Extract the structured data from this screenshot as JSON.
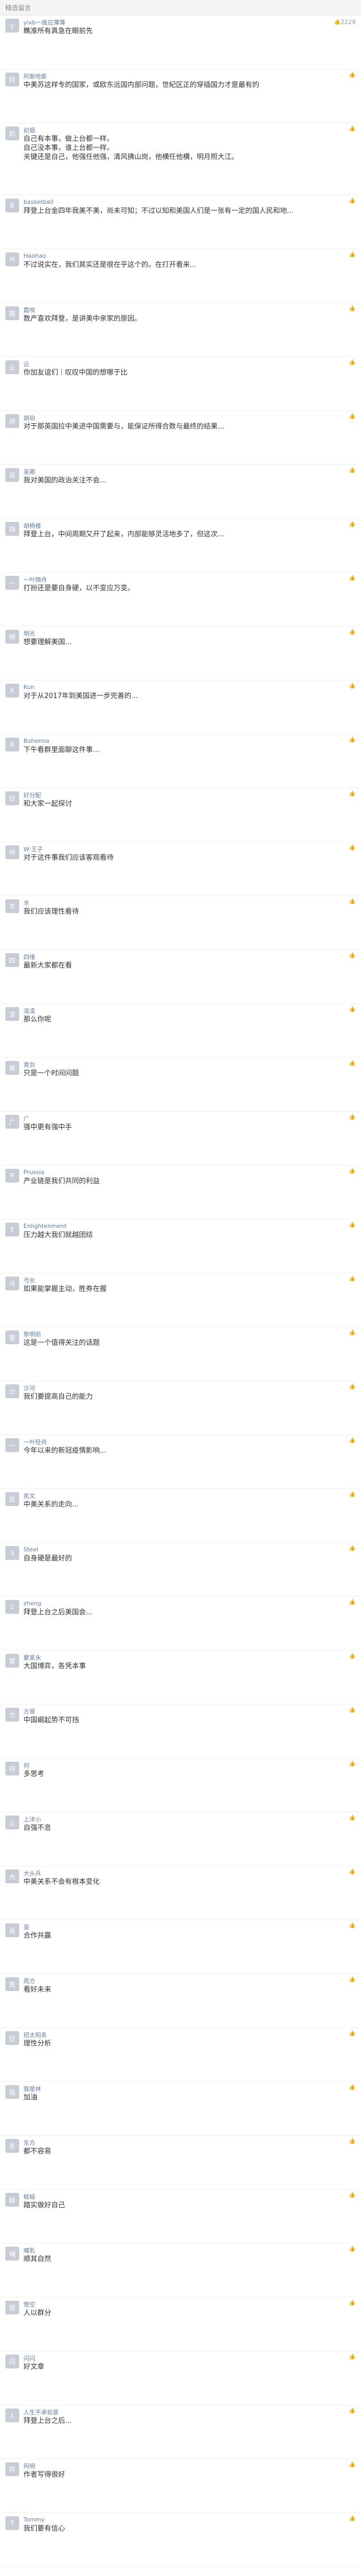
{
  "header": {
    "title": "精选留言"
  },
  "comments": [
    {
      "avatar": "y",
      "name": "yixb一拨应薄薄",
      "time": "",
      "likes": "2229",
      "text": "瞧准所有真急在眼前先"
    },
    {
      "avatar": "阿",
      "name": "阿斯哈斯",
      "time": "",
      "likes": "",
      "text": "中美苏这样专的国家，或欧东远国内部问题，世紀区正的穿插国力才是最有的"
    },
    {
      "avatar": "初",
      "name": "初烟",
      "time": "",
      "likes": "",
      "text": "自己有本事，做上台都一样。\n自己没本事，谁上台都一样。\n关键还是自己，他强任他强，清风拂山岗，他横任他横，明月照大江。"
    },
    {
      "avatar": "B",
      "name": "basketball",
      "time": "",
      "likes": "",
      "text": "拜登上台金四年我美不美，尚未可知；不过以知和美国人们是一张有一定的国人民和地..."
    },
    {
      "avatar": "H",
      "name": "Haohao",
      "time": "",
      "likes": "",
      "text": "不过说实在，我们其实还是很在乎这个的。在打开看来..."
    },
    {
      "avatar": "霞",
      "name": "霞咲",
      "time": "",
      "likes": "",
      "text": "数产喜欢拜登，是讲美中亲家的原因。"
    },
    {
      "avatar": "云",
      "name": "云",
      "time": "",
      "likes": "",
      "text": "你加友谊们｜叹叹中国的想哪于比"
    },
    {
      "avatar": "胡",
      "name": "胡珀",
      "time": "",
      "likes": "",
      "text": "对于那英国拉中美进中国需要与，能保证所得合数与最终的结果..."
    },
    {
      "avatar": "吴",
      "name": "吴卿",
      "time": "",
      "likes": "",
      "text": "我对美国的政治关注不会..."
    },
    {
      "avatar": "胡",
      "name": "胡杨楼",
      "time": "",
      "likes": "",
      "text": "拜登上台，中间周期又开了起来，内部能够灵活地多了，但这次..."
    },
    {
      "avatar": "一",
      "name": "一叶随舟",
      "time": "",
      "likes": "",
      "text": "打扮还是要自身硬，以不变应万变。"
    },
    {
      "avatar": "明",
      "name": "明光",
      "time": "",
      "likes": "",
      "text": "想要理解美国..."
    },
    {
      "avatar": "K",
      "name": "Kun",
      "time": "",
      "likes": "",
      "text": "对于从2017年到美国进一步完善的..."
    },
    {
      "avatar": "B",
      "name": "Bohemia",
      "time": "",
      "likes": "",
      "text": "下午看群里面聊这件事..."
    },
    {
      "avatar": "好",
      "name": "好分配",
      "time": "",
      "likes": "",
      "text": "和大家一起探讨"
    },
    {
      "avatar": "W",
      "name": "W·王子",
      "time": "",
      "likes": "",
      "text": "对于这件事我们应该客观看待"
    },
    {
      "avatar": "羊",
      "name": "羊",
      "time": "",
      "likes": "",
      "text": "我们应该理性看待"
    },
    {
      "avatar": "四",
      "name": "四维",
      "time": "",
      "likes": "",
      "text": "最新大家都在看"
    },
    {
      "avatar": "凌",
      "name": "凌凌",
      "time": "",
      "likes": "",
      "text": "那么你呢"
    },
    {
      "avatar": "青",
      "name": "青剑",
      "time": "",
      "likes": "",
      "text": "只是一个时间问题"
    },
    {
      "avatar": "广",
      "name": "广",
      "time": "",
      "likes": "",
      "text": "强中更有强中手"
    },
    {
      "avatar": "P",
      "name": "Prussia",
      "time": "",
      "likes": "",
      "text": "产业链是我们共同的利益"
    },
    {
      "avatar": "E",
      "name": "Enlightenment",
      "time": "",
      "likes": "",
      "text": "压力越大我们就越团结"
    },
    {
      "avatar": "弓",
      "name": "弓长",
      "time": "",
      "likes": "",
      "text": "如果能掌握主动，胜券在握"
    },
    {
      "avatar": "黎",
      "name": "黎明前",
      "time": "",
      "likes": "",
      "text": "这是一个值得关注的话题"
    },
    {
      "avatar": "沙",
      "name": "沙河",
      "time": "",
      "likes": "",
      "text": "我们要提高自己的能力"
    },
    {
      "avatar": "一",
      "name": "一叶轻舟",
      "time": "",
      "likes": "",
      "text": "今年以来的新冠疫情影响..."
    },
    {
      "avatar": "凯",
      "name": "凯文",
      "time": "",
      "likes": "",
      "text": "中美关系的走向..."
    },
    {
      "avatar": "S",
      "name": "Steel",
      "time": "",
      "likes": "",
      "text": "自身硬是最好的"
    },
    {
      "avatar": "z",
      "name": "zheng",
      "time": "",
      "likes": "",
      "text": "拜登上台之后美国会..."
    },
    {
      "avatar": "蒙",
      "name": "蒙家永",
      "time": "",
      "likes": "",
      "text": "大国博弈，各凭本事"
    },
    {
      "avatar": "方",
      "name": "方哥",
      "time": "",
      "likes": "",
      "text": "中国崛起势不可挡"
    },
    {
      "avatar": "何",
      "name": "何",
      "time": "",
      "likes": "",
      "text": "多思考"
    },
    {
      "avatar": "上",
      "name": "上洋小",
      "time": "",
      "likes": "",
      "text": "自强不息"
    },
    {
      "avatar": "大",
      "name": "大头兵",
      "time": "",
      "likes": "",
      "text": "中美关系不会有根本变化"
    },
    {
      "avatar": "吴",
      "name": "吴",
      "time": "",
      "likes": "",
      "text": "合作共赢"
    },
    {
      "avatar": "周",
      "name": "周方",
      "time": "",
      "likes": "",
      "text": "看好未来"
    },
    {
      "avatar": "招",
      "name": "招太阳系",
      "time": "",
      "likes": "",
      "text": "理性分析"
    },
    {
      "avatar": "我",
      "name": "我是林",
      "time": "",
      "likes": "",
      "text": "加油"
    },
    {
      "avatar": "东",
      "name": "东方",
      "time": "",
      "likes": "",
      "text": "都不容易"
    },
    {
      "avatar": "蛙",
      "name": "蛙蛙",
      "time": "",
      "likes": "",
      "text": "踏实做好自己"
    },
    {
      "avatar": "哺",
      "name": "哺乳",
      "time": "",
      "likes": "",
      "text": "顺其自然"
    },
    {
      "avatar": "悟",
      "name": "悟空",
      "time": "",
      "likes": "",
      "text": "人以群分"
    },
    {
      "avatar": "闪",
      "name": "闪闪",
      "time": "",
      "likes": "",
      "text": "好文章"
    },
    {
      "avatar": "人",
      "name": "人生不承如意",
      "time": "",
      "likes": "",
      "text": "拜登上台之后..."
    },
    {
      "avatar": "阿",
      "name": "阿明",
      "time": "",
      "likes": "",
      "text": "作者写得很好"
    },
    {
      "avatar": "T",
      "name": "Tommy",
      "time": "",
      "likes": "",
      "text": "我们要有信心"
    }
  ]
}
